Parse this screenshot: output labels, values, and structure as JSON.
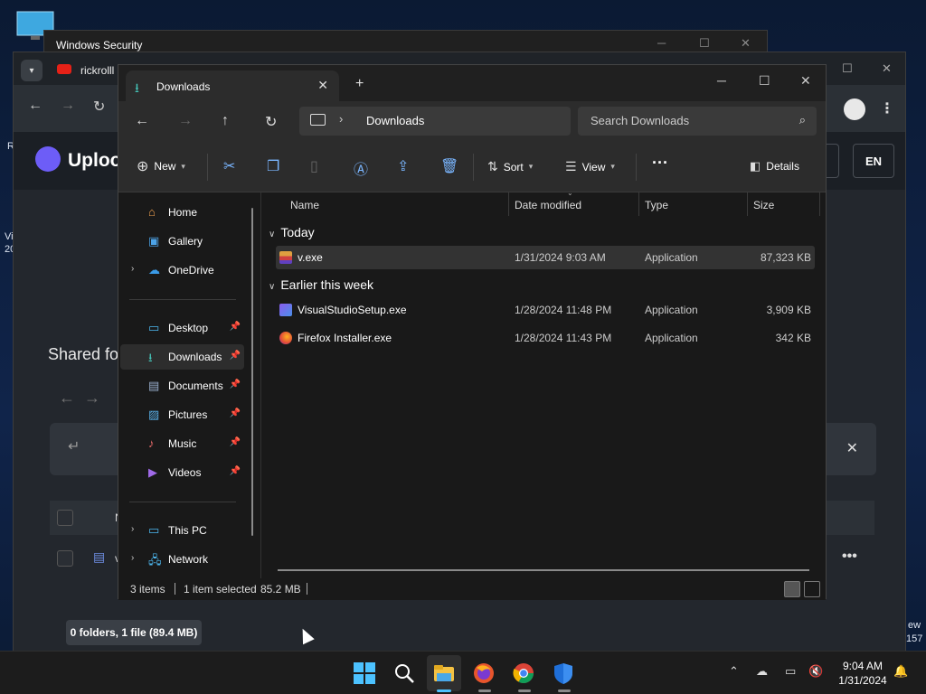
{
  "desktop": {
    "left_fragment_1": "R",
    "left_fragment_2": "Vi",
    "left_fragment_3": "20",
    "right_fragment_1": "ew",
    "right_fragment_2": "157"
  },
  "windows_security": {
    "title": "Windows Security"
  },
  "browser": {
    "tab_title": "rickrolll",
    "page": {
      "logo_text": "Uploo",
      "language": "EN",
      "shared_heading": "Shared fo",
      "row_label_1": "N",
      "row_label_2": "v",
      "footer_text": "0 folders, 1 file (89.4 MB)"
    }
  },
  "explorer": {
    "tab_title": "Downloads",
    "breadcrumb": "Downloads",
    "search_placeholder": "Search Downloads",
    "toolbar": {
      "new_label": "New",
      "sort_label": "Sort",
      "view_label": "View",
      "details_label": "Details"
    },
    "nav": {
      "home": "Home",
      "gallery": "Gallery",
      "onedrive": "OneDrive",
      "desktop": "Desktop",
      "downloads": "Downloads",
      "documents": "Documents",
      "pictures": "Pictures",
      "music": "Music",
      "videos": "Videos",
      "this_pc": "This PC",
      "network": "Network"
    },
    "columns": {
      "name": "Name",
      "date": "Date modified",
      "type": "Type",
      "size": "Size"
    },
    "groups": {
      "today": "Today",
      "earlier": "Earlier this week"
    },
    "files": [
      {
        "name": "v.exe",
        "date": "1/31/2024 9:03 AM",
        "type": "Application",
        "size": "87,323 KB"
      },
      {
        "name": "VisualStudioSetup.exe",
        "date": "1/28/2024 11:48 PM",
        "type": "Application",
        "size": "3,909 KB"
      },
      {
        "name": "Firefox Installer.exe",
        "date": "1/28/2024 11:43 PM",
        "type": "Application",
        "size": "342 KB"
      }
    ],
    "status": {
      "items": "3 items",
      "selected": "1 item selected",
      "selected_size": "85.2 MB"
    }
  },
  "taskbar": {
    "time": "9:04 AM",
    "date": "1/31/2024"
  },
  "colors": {
    "accent": "#4cc2ff",
    "downloads_icon": "#45c4b8"
  }
}
